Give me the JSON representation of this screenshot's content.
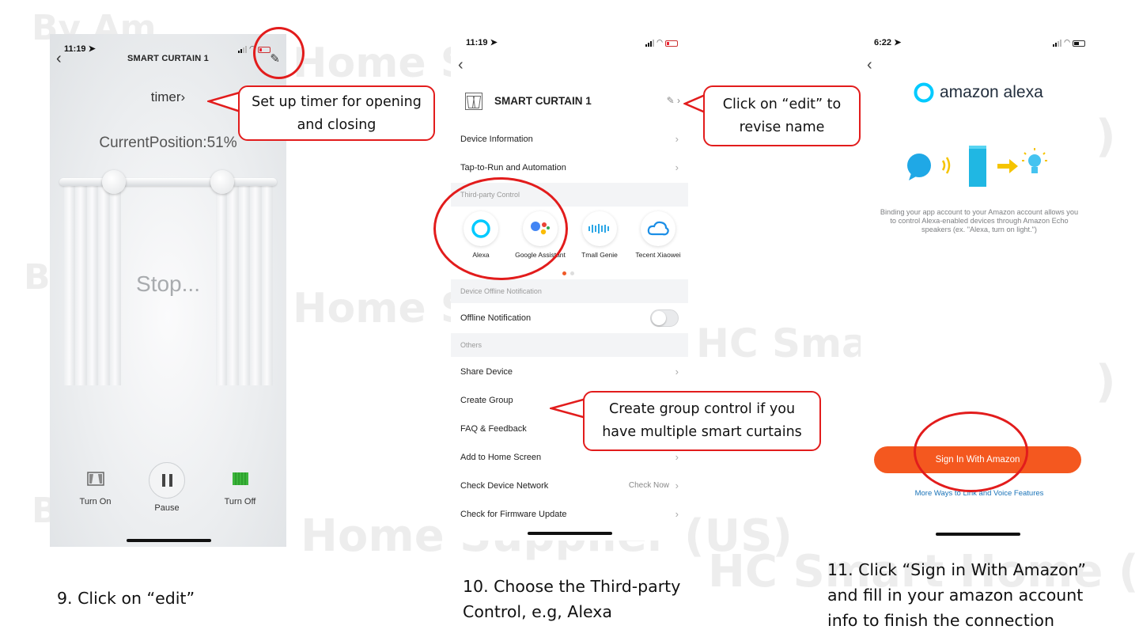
{
  "watermark": "Home Supplier (US) HC Smart Home (US)",
  "steps": {
    "step9": {
      "caption": "9. Click on “edit”",
      "callout": "Set up timer for opening and closing",
      "phone": {
        "time": "11:19",
        "title": "SMART CURTAIN 1",
        "timer": "timer",
        "position": "CurrentPosition:51%",
        "status": "Stop...",
        "turn_on": "Turn On",
        "pause": "Pause",
        "turn_off": "Turn Off"
      }
    },
    "step10": {
      "caption_line1": "10. Choose the Third-party",
      "caption_line2": "Control, e.g, Alexa",
      "callout_edit_line1": "Click on “edit” to",
      "callout_edit_line2": "revise name",
      "callout_group_line1": "Create group control if you",
      "callout_group_line2": "have multiple smart curtains",
      "phone": {
        "time": "11:19",
        "device_name": "SMART CURTAIN 1",
        "device_information": "Device Information",
        "tap_to_run": "Tap-to-Run and Automation",
        "third_party_section": "Third-party Control",
        "third_party": [
          {
            "label": "Alexa"
          },
          {
            "label": "Google Assistant"
          },
          {
            "label": "Tmall Genie"
          },
          {
            "label": "Tecent Xiaowei"
          }
        ],
        "offline_section": "Device Offline Notification",
        "offline_notification": "Offline Notification",
        "offline_enabled": false,
        "others_section": "Others",
        "share_device": "Share Device",
        "create_group": "Create Group",
        "faq": "FAQ & Feedback",
        "add_home": "Add to Home Screen",
        "check_network": "Check Device Network",
        "check_now": "Check Now",
        "firmware": "Check for Firmware Update"
      }
    },
    "step11": {
      "caption_line1": "11. Click “Sign in With Amazon”",
      "caption_line2": "and fill in your amazon account",
      "caption_line3": "info to finish the connection",
      "phone": {
        "time": "6:22",
        "logo_text": "amazon alexa",
        "description": "Binding your app account to your Amazon account allows you to control Alexa-enabled devices through Amazon Echo speakers (ex. \"Alexa, turn on light.\")",
        "sign_in": "Sign In With Amazon",
        "more_ways": "More Ways to Link and Voice Features"
      }
    }
  },
  "colors": {
    "annotation_red": "#e21c1c",
    "amazon_orange": "#f4581f",
    "alexa_blue": "#00caff",
    "link_blue": "#1a73b8"
  }
}
